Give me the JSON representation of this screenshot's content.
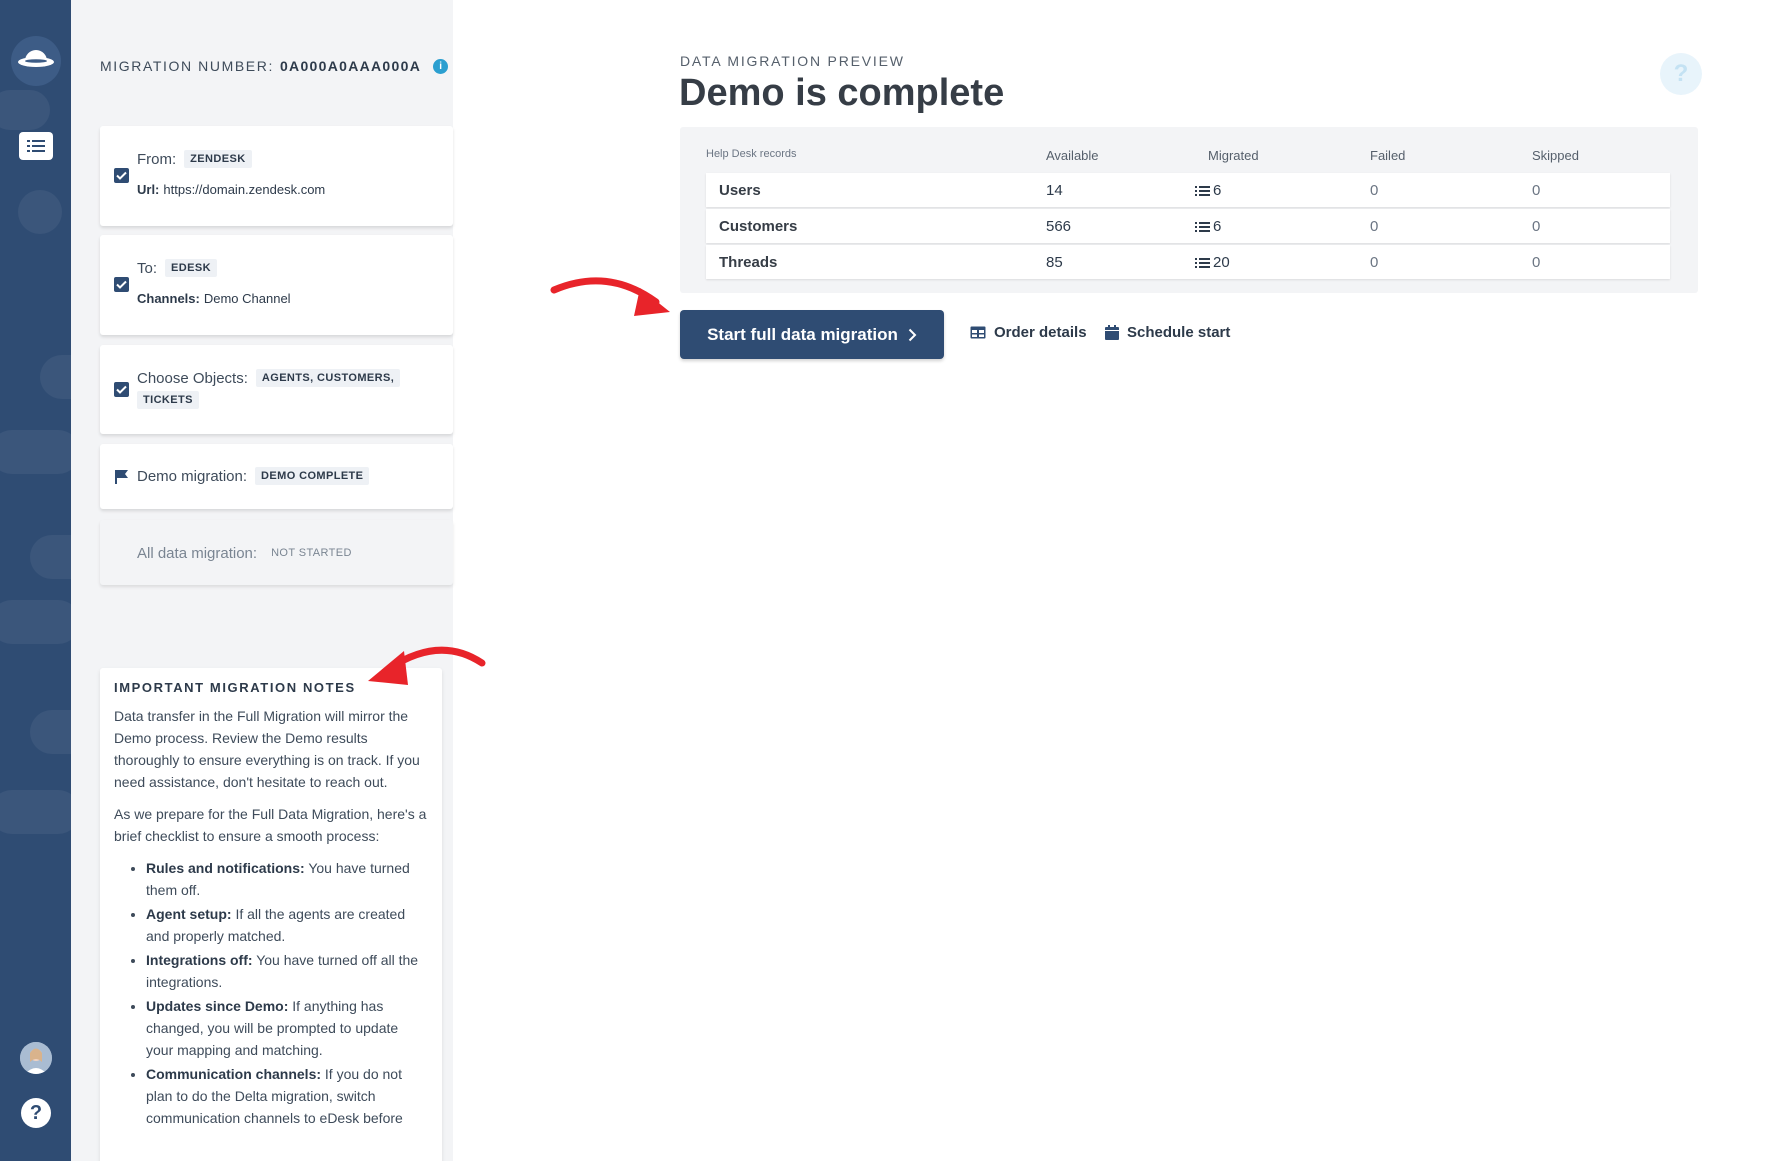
{
  "migration": {
    "number_label": "MIGRATION NUMBER:",
    "number_value": "0A000A0AAA000A",
    "info_icon": "i"
  },
  "steps": {
    "from": {
      "label": "From:",
      "tag": "ZENDESK",
      "url_label": "Url:",
      "url_value": "https://domain.zendesk.com"
    },
    "to": {
      "label": "To:",
      "tag": "EDESK",
      "channels_label": "Channels:",
      "channels_value": "Demo Channel"
    },
    "objects": {
      "label": "Choose Objects:",
      "tag1": "AGENTS, CUSTOMERS,",
      "tag2": "TICKETS"
    },
    "demo": {
      "label": "Demo migration:",
      "tag": "DEMO COMPLETE"
    },
    "all": {
      "label": "All data migration:",
      "tag": "NOT STARTED"
    }
  },
  "notes": {
    "title": "IMPORTANT MIGRATION NOTES",
    "p1": "Data transfer in the Full Migration will mirror the Demo process. Review the Demo results thoroughly to ensure everything is on track. If you need assistance, don't hesitate to reach out.",
    "p2": "As we prepare for the Full Data Migration, here's a brief checklist to ensure a smooth process:",
    "items": [
      {
        "title": "Rules and notifications:",
        "text": "You have turned them off."
      },
      {
        "title": "Agent setup:",
        "text": "If all the agents are created and properly matched."
      },
      {
        "title": "Integrations off:",
        "text": "You have turned off all the integrations."
      },
      {
        "title": "Updates since Demo:",
        "text": "If anything has changed, you will be prompted to update your mapping and matching."
      },
      {
        "title": "Communication channels:",
        "text": "If you do not plan to do the Delta migration, switch communication channels to eDesk before"
      }
    ]
  },
  "main": {
    "kicker": "DATA MIGRATION PREVIEW",
    "title": "Demo is complete",
    "help_icon": "?"
  },
  "table": {
    "headers": [
      "Help Desk records",
      "Available",
      "Migrated",
      "Failed",
      "Skipped"
    ],
    "rows": [
      {
        "name": "Users",
        "available": "14",
        "migrated": "6",
        "failed": "0",
        "skipped": "0"
      },
      {
        "name": "Customers",
        "available": "566",
        "migrated": "6",
        "failed": "0",
        "skipped": "0"
      },
      {
        "name": "Threads",
        "available": "85",
        "migrated": "20",
        "failed": "0",
        "skipped": "0"
      }
    ]
  },
  "actions": {
    "start_label": "Start full data migration",
    "order_label": "Order details",
    "schedule_label": "Schedule start"
  },
  "sidebar": {
    "help_label": "?"
  },
  "colors": {
    "brand": "#2f4c73",
    "accent_arrow": "#e8242a",
    "info": "#2b9fd0"
  }
}
